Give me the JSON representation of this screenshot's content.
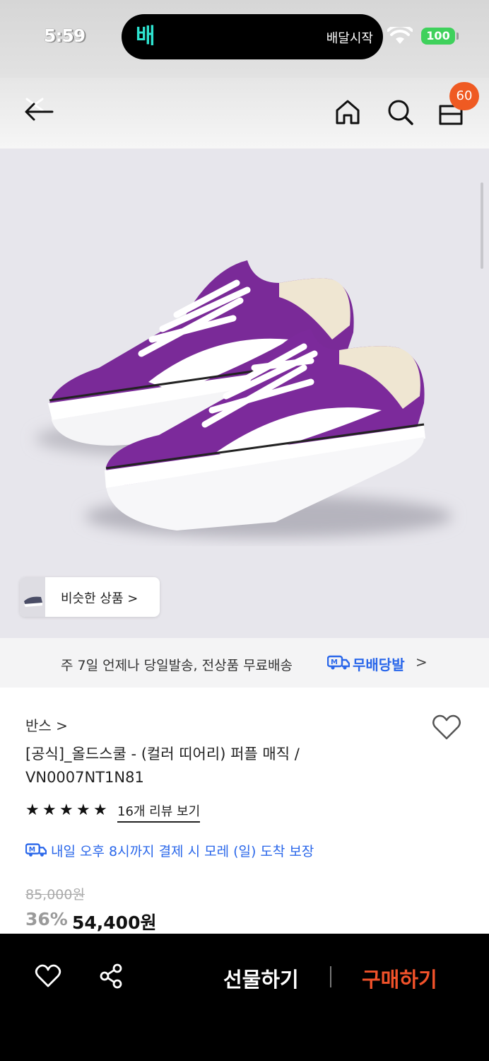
{
  "status_bar": {
    "time": "5:59",
    "island_app_logo": "배",
    "island_text": "배달시작",
    "battery": "100"
  },
  "header": {
    "cart_count": "60"
  },
  "product_image": {
    "similar_label": "비슷한 상품 >"
  },
  "delivery_banner": {
    "text": "주 7일 언제나 당일발송, 전상품 무료배송",
    "logo_text": "무배당발",
    "chevron": ">"
  },
  "product": {
    "brand": "반스 >",
    "title": "[공식]_올드스쿨 - (컬러 띠어리) 퍼플 매직 / VN0007NT1N81",
    "rating_stars": 5,
    "review_link": "16개 리뷰 보기",
    "arrival_notice": "내일 오후 8시까지 결제 시 모레 (일) 도착 보장",
    "original_price": "85,000원",
    "discount": "36%",
    "sale_price": "54,400원"
  },
  "bottom_bar": {
    "gift_label": "선물하기",
    "buy_label": "구매하기"
  },
  "colors": {
    "accent_orange": "#f1522a",
    "link_blue": "#2a67ea",
    "badge": "#ef5a22",
    "shoe_purple": "#7c2a9b"
  },
  "icons": [
    "back-icon",
    "home-icon",
    "search-icon",
    "shopping-bag-icon",
    "heart-icon",
    "share-icon",
    "delivery-truck-icon",
    "wifi-icon"
  ]
}
